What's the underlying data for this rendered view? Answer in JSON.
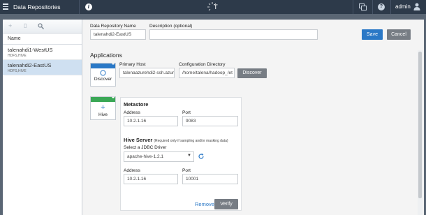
{
  "topbar": {
    "title": "Data Repositories",
    "logo_text": "T",
    "user_name": "admin",
    "icons": [
      "menu-icon",
      "info-icon",
      "talend-logo",
      "monitor-icon",
      "help-icon",
      "user-icon"
    ]
  },
  "sidebar": {
    "column_header": "Name",
    "items": [
      {
        "name": "talenahdi1-WestUS",
        "type": "HDFS,HIVE",
        "selected": false
      },
      {
        "name": "talenahdi2-EastUS",
        "type": "HDFS,HIVE",
        "selected": true
      }
    ]
  },
  "form": {
    "repo_name_label": "Data Repository Name",
    "repo_name_value": "talenahdi2-EastUS",
    "description_label": "Description (optional)",
    "description_value": "",
    "save_label": "Save",
    "cancel_label": "Cancel"
  },
  "applications": {
    "title": "Applications",
    "discover_card": {
      "label": "Discover",
      "primary_host_label": "Primary Host",
      "primary_host_value": "talenaazurehdi2-ssh.azure",
      "config_dir_label": "Configuration Directory",
      "config_dir_value": "/home/talena/hadoop_/et",
      "discover_button": "Discover"
    },
    "hive_card": {
      "label": "Hive",
      "metastore": {
        "title": "Metastore",
        "address_label": "Address",
        "address_value": "10.2.1.16",
        "port_label": "Port",
        "port_value": "9083"
      },
      "hive_server": {
        "title": "Hive Server",
        "hint": "(Required only if sampling and/or masking data)",
        "jdbc_label": "Select a JDBC Driver",
        "jdbc_value": "apache-hive-1.2.1",
        "address_label": "Address",
        "address_value": "10.2.1.16",
        "port_label": "Port",
        "port_value": "10001"
      },
      "remove_label": "Remove",
      "verify_label": "Verify"
    }
  },
  "colors": {
    "topbar": "#2d3a4a",
    "primary": "#2a78c6",
    "discover_strip": "#2a78c6",
    "hive_strip": "#3aa755",
    "selected_row": "#cfe0f1"
  }
}
